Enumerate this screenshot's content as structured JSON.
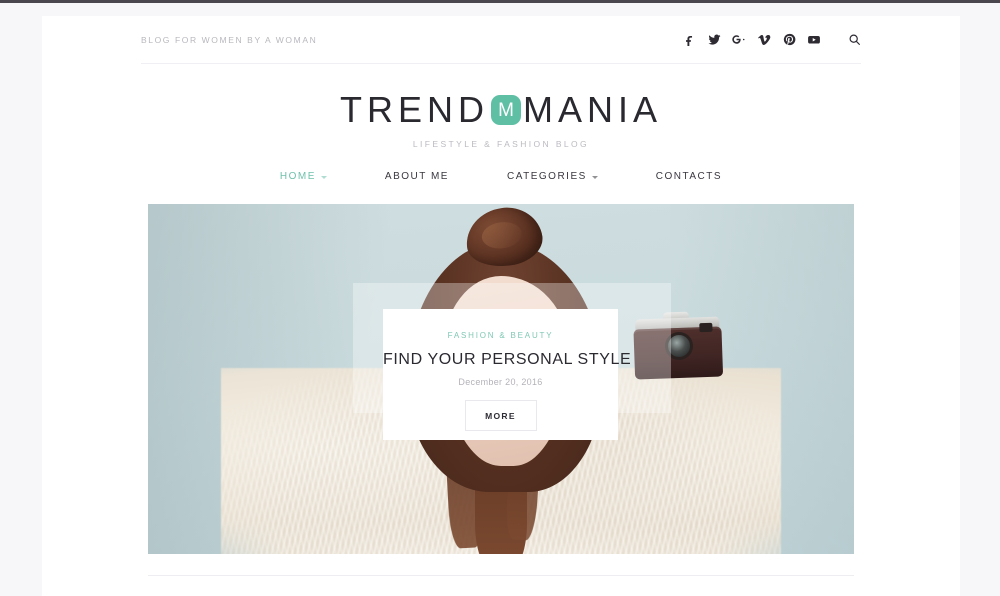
{
  "topbar": {
    "tagline": "BLOG FOR WOMEN BY A WOMAN",
    "social": [
      {
        "name": "facebook-icon",
        "label": "Facebook"
      },
      {
        "name": "twitter-icon",
        "label": "Twitter"
      },
      {
        "name": "google-plus-icon",
        "label": "Google Plus"
      },
      {
        "name": "vimeo-icon",
        "label": "Vimeo"
      },
      {
        "name": "pinterest-icon",
        "label": "Pinterest"
      },
      {
        "name": "youtube-icon",
        "label": "YouTube"
      }
    ],
    "search_label": "Search"
  },
  "branding": {
    "logo_part1": "TREND",
    "logo_badge_letter": "M",
    "logo_part2": "MANIA",
    "subtitle": "LIFESTYLE & FASHION BLOG",
    "accent_color": "#5fbfa4"
  },
  "nav": {
    "items": [
      {
        "label": "HOME",
        "active": true,
        "has_dropdown": true
      },
      {
        "label": "ABOUT ME",
        "active": false,
        "has_dropdown": false
      },
      {
        "label": "CATEGORIES",
        "active": false,
        "has_dropdown": true
      },
      {
        "label": "CONTACTS",
        "active": false,
        "has_dropdown": false
      }
    ],
    "active_color": "#6fc0ab"
  },
  "hero": {
    "category": "FASHION & BEAUTY",
    "title": "FIND YOUR PERSONAL STYLE",
    "date": "December 20, 2016",
    "button_label": "MORE",
    "photo_alt": "Woman with auburn top-bun hair in a fluffy cream coat holding a vintage camera",
    "background_color": "#c9dadd",
    "category_color": "#7fc8b4"
  },
  "theme": {
    "page_background": "#f7f6f9",
    "container_background": "#ffffff",
    "text_color": "#2b2930",
    "muted_text_color": "#b9b7bd"
  }
}
